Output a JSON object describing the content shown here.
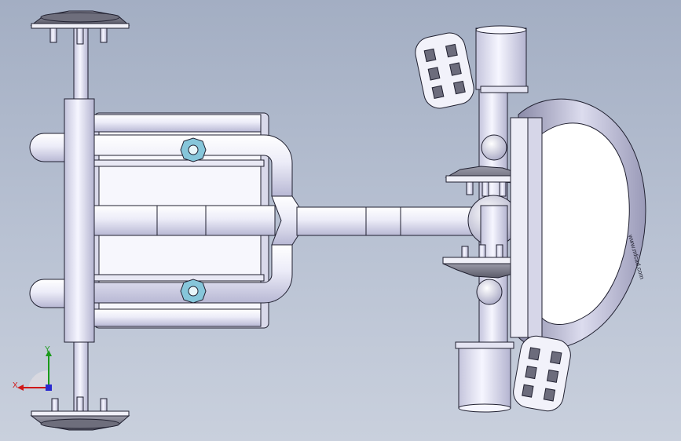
{
  "viewport": {
    "background_top": "#a3aec3",
    "background_bottom": "#c9d0dd"
  },
  "model": {
    "description_icon": "cad-assembly-icon",
    "rim_engraving": "www.mfcad.com",
    "part_fill": "#f4f4fb",
    "part_shade": "#cfcfe4",
    "edge_color": "#202030",
    "nut_color": "#86c6da"
  },
  "triad": {
    "x_label": "X",
    "y_label": "Y",
    "x_color": "#d01818",
    "y_color": "#1a9a1a",
    "z_color": "#2a2ad0"
  }
}
